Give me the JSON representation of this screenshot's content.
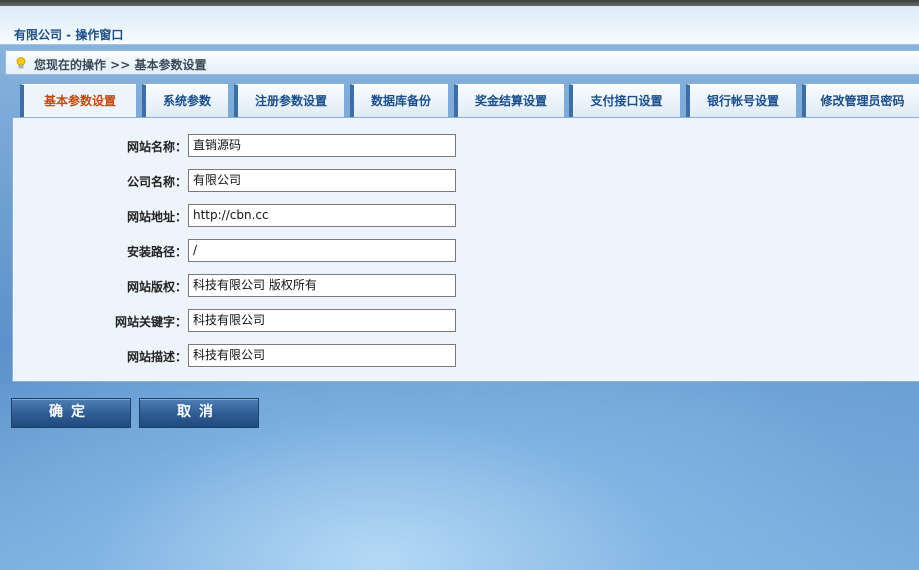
{
  "window": {
    "title": "有限公司 - 操作窗口"
  },
  "breadcrumb": {
    "icon": "lightbulb-icon",
    "text": "您现在的操作 >> 基本参数设置"
  },
  "tabs": [
    {
      "label": "基本参数设置",
      "active": true
    },
    {
      "label": "系统参数",
      "active": false
    },
    {
      "label": "注册参数设置",
      "active": false
    },
    {
      "label": "数据库备份",
      "active": false
    },
    {
      "label": "奖金结算设置",
      "active": false
    },
    {
      "label": "支付接口设置",
      "active": false
    },
    {
      "label": "银行帐号设置",
      "active": false
    },
    {
      "label": "修改管理员密码",
      "active": false
    }
  ],
  "form": {
    "fields": [
      {
        "label": "网站名称：",
        "value": "直销源码"
      },
      {
        "label": "公司名称：",
        "value": "有限公司"
      },
      {
        "label": "网站地址：",
        "value": "http://cbn.cc"
      },
      {
        "label": "安装路径：",
        "value": "/"
      },
      {
        "label": "网站版权：",
        "value": "科技有限公司 版权所有"
      },
      {
        "label": "网站关键字：",
        "value": "科技有限公司"
      },
      {
        "label": "网站描述：",
        "value": "科技有限公司"
      }
    ]
  },
  "buttons": {
    "confirm": "确定",
    "cancel": "取消"
  },
  "colors": {
    "active_tab_text": "#c24a10",
    "tab_text": "#1c4f8a",
    "button_bg": "#2f5f97"
  }
}
